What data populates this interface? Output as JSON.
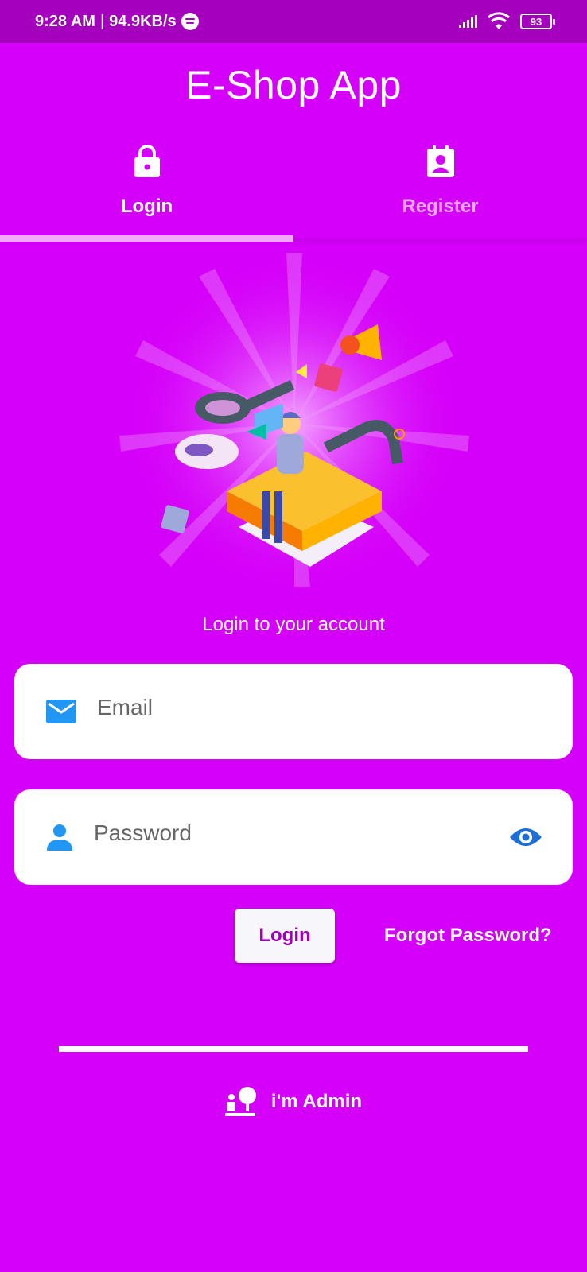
{
  "status_bar": {
    "time": "9:28 AM",
    "separator": "|",
    "net_speed": "94.9KB/s",
    "battery": "93"
  },
  "app": {
    "title": "E-Shop App"
  },
  "tabs": [
    {
      "label": "Login",
      "icon": "lock-icon",
      "active": true
    },
    {
      "label": "Register",
      "icon": "contact-card-icon",
      "active": false
    }
  ],
  "form": {
    "subtitle": "Login to your account",
    "email_placeholder": "Email",
    "password_placeholder": "Password",
    "login_label": "Login",
    "forgot_label": "Forgot Password?"
  },
  "admin": {
    "label": "i'm Admin"
  },
  "colors": {
    "background": "#d500f9",
    "status_bar": "#a400bd",
    "field_icon": "#2196f3",
    "login_text": "#a000b5"
  }
}
